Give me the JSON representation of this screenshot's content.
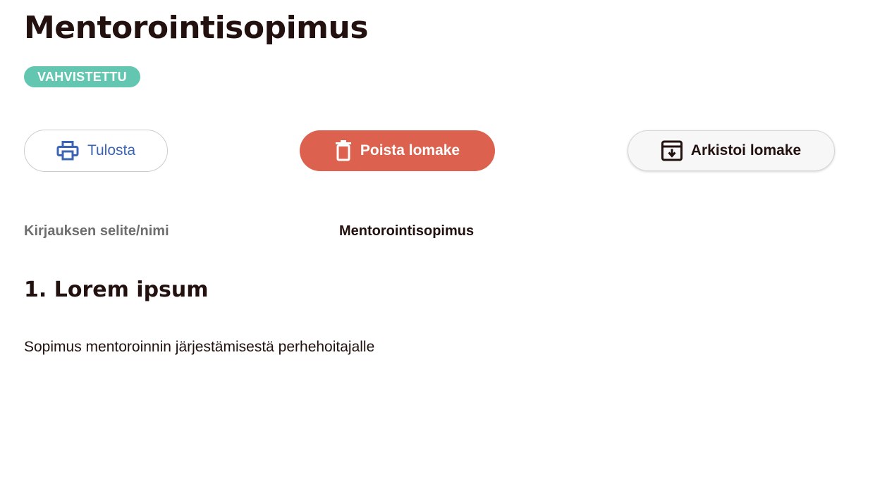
{
  "form": {
    "title": "Mentorointisopimus",
    "status_badge": "VAHVISTETTU"
  },
  "actions": {
    "print_label": "Tulosta",
    "delete_label": "Poista lomake",
    "archive_label": "Arkistoi lomake"
  },
  "fields": [
    {
      "label": "Kirjauksen selite/nimi",
      "value": "Mentorointisopimus"
    }
  ],
  "sections": [
    {
      "heading": "1. Lorem ipsum",
      "text": "Sopimus mentoroinnin järjestämisestä perhehoitajalle"
    }
  ],
  "colors": {
    "badge_bg": "#63c6b1",
    "delete_bg": "#dc614e",
    "print_accent": "#3c64b4",
    "text_primary": "#22110e",
    "text_label": "#6e6e6e"
  },
  "icons": {
    "print": "printer-icon",
    "delete": "trash-icon",
    "archive": "archive-icon"
  }
}
